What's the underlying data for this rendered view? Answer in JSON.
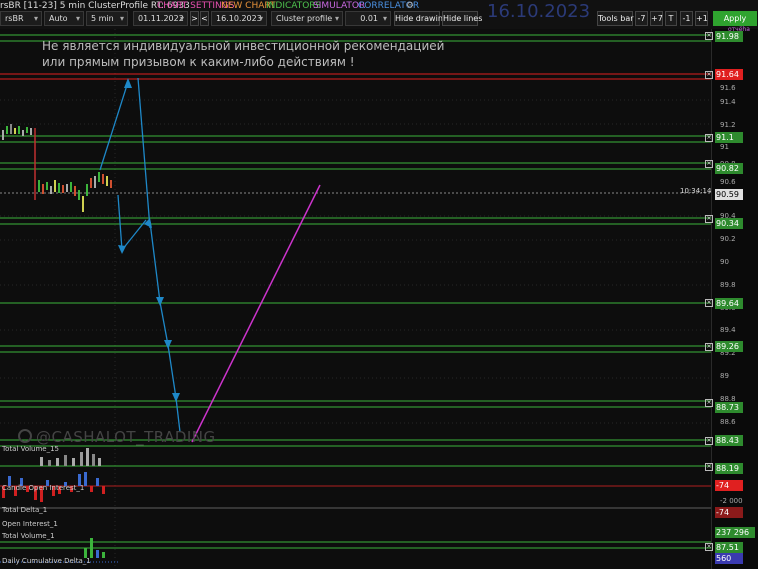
{
  "toolbar": {
    "title": "rsBR [11-23] 5 min ClusterProfile RT: 6933",
    "menu": [
      {
        "label": "CHART SETTINGS",
        "color": "#e84fb0"
      },
      {
        "label": "NEW CHART",
        "color": "#e8923a"
      },
      {
        "label": "INDICATORS",
        "color": "#4ec24e"
      },
      {
        "label": "SIMULATOR",
        "color": "#c868e0"
      },
      {
        "label": "CORRELATOR",
        "color": "#4a8fe0"
      }
    ],
    "symbol": "rsBR",
    "mode": "Auto",
    "timeframe": "5 min",
    "date_from": "01.11.2022",
    "date_to": "16.10.2023",
    "chart_type": "Cluster profile",
    "step": "0.01",
    "hide_drawing": "Hide drawing",
    "hide_lines": "Hide lines",
    "big_date": "16.10.2023",
    "tools_bar": "Tools bar",
    "steps": [
      "-7",
      "+7",
      "T",
      "-1",
      "+1"
    ],
    "apply": "Apply",
    "nav_prev": ">",
    "nav_next": "<"
  },
  "disclaimer": {
    "line1": "Не является индивидуальной инвестиционной рекомендацией",
    "line2": "или прямым призывом к каким-либо действиям !"
  },
  "price_scale": {
    "ticks": [
      "91.6",
      "91.4",
      "91.2",
      "91",
      "90.8",
      "90.6",
      "90.4",
      "90.2",
      "90",
      "89.8",
      "89.6",
      "89.4",
      "89.2",
      "89",
      "88.8",
      "88.6"
    ],
    "levels": [
      {
        "value": "91.98",
        "color": "#2e8b2e"
      },
      {
        "value": "91.64",
        "color": "#e02020"
      },
      {
        "value": "91.1",
        "color": "#2e8b2e"
      },
      {
        "value": "90.82",
        "color": "#2e8b2e"
      },
      {
        "value": "90.59",
        "color": "#e0e0e0"
      },
      {
        "value": "90.34",
        "color": "#2e8b2e"
      },
      {
        "value": "89.64",
        "color": "#2e8b2e"
      },
      {
        "value": "89.26",
        "color": "#2e8b2e"
      },
      {
        "value": "88.73",
        "color": "#2e8b2e"
      },
      {
        "value": "88.43",
        "color": "#2e8b2e"
      },
      {
        "value": "88.19",
        "color": "#2e8b2e"
      },
      {
        "value": "-74",
        "color": "#e02020"
      },
      {
        "value": "-74",
        "color": "#8b1a1a"
      },
      {
        "value": "237 296",
        "color": "#2e8b2e"
      },
      {
        "value": "87.51",
        "color": "#2e8b2e"
      },
      {
        "value": "560",
        "color": "#3a3ab0"
      }
    ],
    "extra": {
      "minus2000": "-2 000",
      "ochr": "отчёhа"
    }
  },
  "time_label": "10:34:14",
  "subpanels": [
    "Total Volume_15",
    "Candle Open Interest_1",
    "Total Delta_1",
    "Open Interest_1",
    "Total Volume_1",
    "Daily Cumulative Delta_1"
  ],
  "watermark": "@CASHALOT_TRADING",
  "colors": {
    "background": "#0d0d0d",
    "level_line": "#3cb43c",
    "resistance": "#e02020",
    "arrow": "#1e88c8",
    "trend": "#cc33cc",
    "apply_button": "#2fa32f"
  }
}
